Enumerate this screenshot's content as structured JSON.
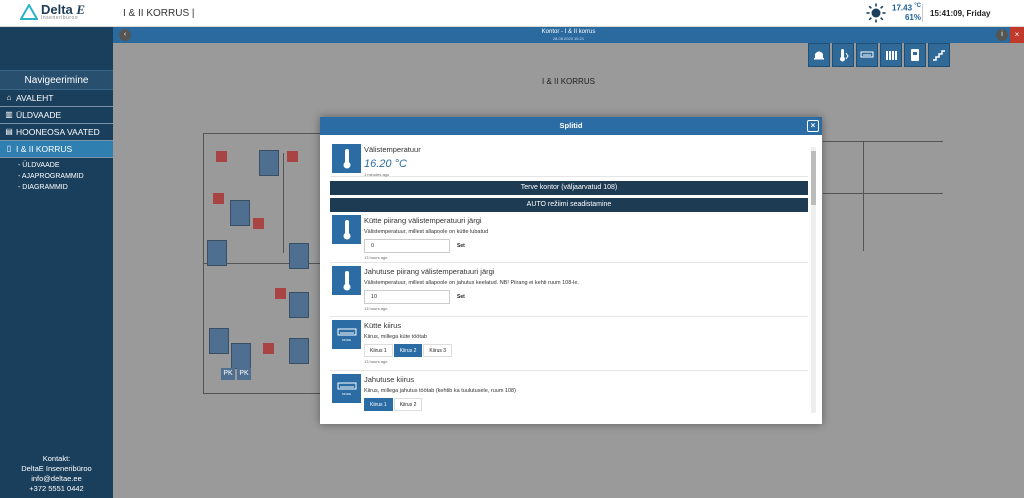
{
  "header": {
    "logo_name": "Delta",
    "logo_letter": "E",
    "logo_sub": "Inseneribüroo",
    "title": "I & II KORRUS |",
    "temperature": "17.43",
    "temp_unit": "°C",
    "humidity": "61%",
    "clock": "15:41:09, Friday"
  },
  "sidebar": {
    "title": "Navigeerimine",
    "items": [
      {
        "label": "AVALEHT",
        "icon": "home-icon"
      },
      {
        "label": "ÜLDVAADE",
        "icon": "building-icon"
      },
      {
        "label": "HOONEOSA VAATED",
        "icon": "building-part-icon"
      },
      {
        "label": "I & II KORRUS",
        "icon": "floor-icon"
      }
    ],
    "subitems": [
      "- ÜLDVAADE",
      "- AJAPROGRAMMID",
      "- DIAGRAMMID"
    ],
    "contact": {
      "label": "Kontakt:",
      "company": "DeltaE Inseneribüroo",
      "email": "info@deltae.ee",
      "phone": "+372 5551 0442"
    }
  },
  "main": {
    "header_title": "Kontor - I & II korrus",
    "header_sub": "28.08.2020 15:21",
    "floor_title": "I & II KORRUS",
    "pk1": "PK",
    "pk2": "PK"
  },
  "modal": {
    "title": "Splitid",
    "close": "×",
    "outdoor": {
      "title": "Välistemperatuur",
      "value": "16.20 °C",
      "time": "1 minutes ago"
    },
    "bar1": "Terve kontor (väljaarvatud 108)",
    "bar2": "AUTO režiimi seadistamine",
    "heat_limit": {
      "title": "Kütte piirang välistemperatuuri järgi",
      "desc": "Välistemperatuur, millest allapoole on kütte lubatud",
      "value": "0",
      "button": "Set",
      "time": "13 hours ago"
    },
    "cool_limit": {
      "title": "Jahutuse piirang välistemperatuuri järgi",
      "desc": "Välistemperatuur, millest allapoole on jahutus keelatud. NB! Piirang ei kehti ruum 108-le.",
      "value": "10",
      "button": "Set",
      "time": "13 hours ago"
    },
    "heat_speed": {
      "title": "Kütte kiirus",
      "desc": "Kiirus, millega küte töötab",
      "options": [
        "Kiirus 1",
        "Kiirus 2",
        "Kiirus 3"
      ],
      "selected": 1,
      "time": "13 hours ago"
    },
    "cool_speed": {
      "title": "Jahutuse kiirus",
      "desc": "Kiirus, millega jahutus töötab (kehtib ka tuulutusele, ruum 108)",
      "options": [
        "Kiirus 1",
        "Kiirus 2"
      ],
      "selected": 0
    },
    "icon_label_mode": "MODE"
  }
}
